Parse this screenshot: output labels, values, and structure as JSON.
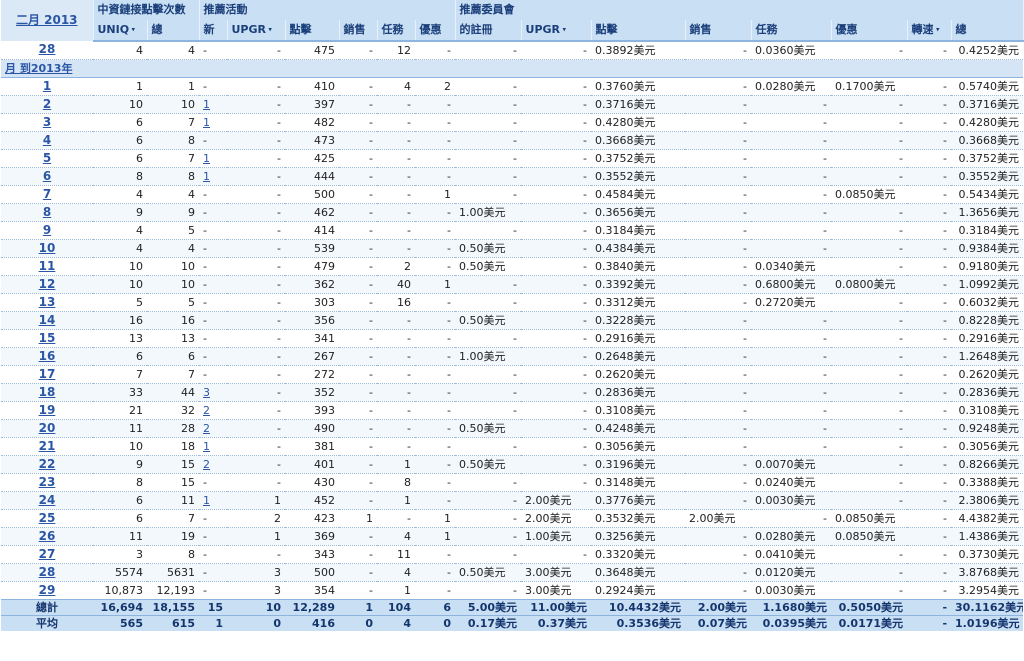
{
  "header": {
    "month_link": "二月 2013",
    "group_direct_clicks": "中資鏈接點擊次數",
    "group_campaign": "推薦活動",
    "group_committee": "推薦委員會",
    "cols": [
      "UNIQ",
      "總",
      "新",
      "UPGR",
      "點擊",
      "銷售",
      "任務",
      "優惠",
      "的註冊",
      "UPGR",
      "點擊",
      "銷售",
      "任務",
      "優惠",
      "轉速",
      "總"
    ],
    "sort_arrow": "▾"
  },
  "first_row": [
    "28",
    "4",
    "4",
    "-",
    "-",
    "475",
    "-",
    "12",
    "-",
    "-",
    "-",
    "0.3892美元",
    "-",
    "0.0360美元",
    "-",
    "-",
    "0.4252美元"
  ],
  "section_label": "月 到2013年",
  "rows": [
    [
      "1",
      "1",
      "1",
      "-",
      "-",
      "410",
      "-",
      "4",
      "2",
      "-",
      "-",
      "0.3760美元",
      "-",
      "0.0280美元",
      "0.1700美元",
      "-",
      "0.5740美元"
    ],
    [
      "2",
      "10",
      "10",
      "1",
      "-",
      "397",
      "-",
      "-",
      "-",
      "-",
      "-",
      "0.3716美元",
      "-",
      "-",
      "-",
      "-",
      "0.3716美元"
    ],
    [
      "3",
      "6",
      "7",
      "1",
      "-",
      "482",
      "-",
      "-",
      "-",
      "-",
      "-",
      "0.4280美元",
      "-",
      "-",
      "-",
      "-",
      "0.4280美元"
    ],
    [
      "4",
      "6",
      "8",
      "-",
      "-",
      "473",
      "-",
      "-",
      "-",
      "-",
      "-",
      "0.3668美元",
      "-",
      "-",
      "-",
      "-",
      "0.3668美元"
    ],
    [
      "5",
      "6",
      "7",
      "1",
      "-",
      "425",
      "-",
      "-",
      "-",
      "-",
      "-",
      "0.3752美元",
      "-",
      "-",
      "-",
      "-",
      "0.3752美元"
    ],
    [
      "6",
      "8",
      "8",
      "1",
      "-",
      "444",
      "-",
      "-",
      "-",
      "-",
      "-",
      "0.3552美元",
      "-",
      "-",
      "-",
      "-",
      "0.3552美元"
    ],
    [
      "7",
      "4",
      "4",
      "-",
      "-",
      "500",
      "-",
      "-",
      "1",
      "-",
      "-",
      "0.4584美元",
      "-",
      "-",
      "0.0850美元",
      "-",
      "0.5434美元"
    ],
    [
      "8",
      "9",
      "9",
      "-",
      "-",
      "462",
      "-",
      "-",
      "-",
      "1.00美元",
      "-",
      "0.3656美元",
      "-",
      "-",
      "-",
      "-",
      "1.3656美元"
    ],
    [
      "9",
      "4",
      "5",
      "-",
      "-",
      "414",
      "-",
      "-",
      "-",
      "-",
      "-",
      "0.3184美元",
      "-",
      "-",
      "-",
      "-",
      "0.3184美元"
    ],
    [
      "10",
      "4",
      "4",
      "-",
      "-",
      "539",
      "-",
      "-",
      "-",
      "0.50美元",
      "-",
      "0.4384美元",
      "-",
      "-",
      "-",
      "-",
      "0.9384美元"
    ],
    [
      "11",
      "10",
      "10",
      "-",
      "-",
      "479",
      "-",
      "2",
      "-",
      "0.50美元",
      "-",
      "0.3840美元",
      "-",
      "0.0340美元",
      "-",
      "-",
      "0.9180美元"
    ],
    [
      "12",
      "10",
      "10",
      "-",
      "-",
      "362",
      "-",
      "40",
      "1",
      "-",
      "-",
      "0.3392美元",
      "-",
      "0.6800美元",
      "0.0800美元",
      "-",
      "1.0992美元"
    ],
    [
      "13",
      "5",
      "5",
      "-",
      "-",
      "303",
      "-",
      "16",
      "-",
      "-",
      "-",
      "0.3312美元",
      "-",
      "0.2720美元",
      "-",
      "-",
      "0.6032美元"
    ],
    [
      "14",
      "16",
      "16",
      "-",
      "-",
      "356",
      "-",
      "-",
      "-",
      "0.50美元",
      "-",
      "0.3228美元",
      "-",
      "-",
      "-",
      "-",
      "0.8228美元"
    ],
    [
      "15",
      "13",
      "13",
      "-",
      "-",
      "341",
      "-",
      "-",
      "-",
      "-",
      "-",
      "0.2916美元",
      "-",
      "-",
      "-",
      "-",
      "0.2916美元"
    ],
    [
      "16",
      "6",
      "6",
      "-",
      "-",
      "267",
      "-",
      "-",
      "-",
      "1.00美元",
      "-",
      "0.2648美元",
      "-",
      "-",
      "-",
      "-",
      "1.2648美元"
    ],
    [
      "17",
      "7",
      "7",
      "-",
      "-",
      "272",
      "-",
      "-",
      "-",
      "-",
      "-",
      "0.2620美元",
      "-",
      "-",
      "-",
      "-",
      "0.2620美元"
    ],
    [
      "18",
      "33",
      "44",
      "3",
      "-",
      "352",
      "-",
      "-",
      "-",
      "-",
      "-",
      "0.2836美元",
      "-",
      "-",
      "-",
      "-",
      "0.2836美元"
    ],
    [
      "19",
      "21",
      "32",
      "2",
      "-",
      "393",
      "-",
      "-",
      "-",
      "-",
      "-",
      "0.3108美元",
      "-",
      "-",
      "-",
      "-",
      "0.3108美元"
    ],
    [
      "20",
      "11",
      "28",
      "2",
      "-",
      "490",
      "-",
      "-",
      "-",
      "0.50美元",
      "-",
      "0.4248美元",
      "-",
      "-",
      "-",
      "-",
      "0.9248美元"
    ],
    [
      "21",
      "10",
      "18",
      "1",
      "-",
      "381",
      "-",
      "-",
      "-",
      "-",
      "-",
      "0.3056美元",
      "-",
      "-",
      "-",
      "-",
      "0.3056美元"
    ],
    [
      "22",
      "9",
      "15",
      "2",
      "-",
      "401",
      "-",
      "1",
      "-",
      "0.50美元",
      "-",
      "0.3196美元",
      "-",
      "0.0070美元",
      "-",
      "-",
      "0.8266美元"
    ],
    [
      "23",
      "8",
      "15",
      "-",
      "-",
      "430",
      "-",
      "8",
      "-",
      "-",
      "-",
      "0.3148美元",
      "-",
      "0.0240美元",
      "-",
      "-",
      "0.3388美元"
    ],
    [
      "24",
      "6",
      "11",
      "1",
      "1",
      "452",
      "-",
      "1",
      "-",
      "-",
      "2.00美元",
      "0.3776美元",
      "-",
      "0.0030美元",
      "-",
      "-",
      "2.3806美元"
    ],
    [
      "25",
      "6",
      "7",
      "-",
      "2",
      "423",
      "1",
      "-",
      "1",
      "-",
      "2.00美元",
      "0.3532美元",
      "2.00美元",
      "-",
      "0.0850美元",
      "-",
      "4.4382美元"
    ],
    [
      "26",
      "11",
      "19",
      "-",
      "1",
      "369",
      "-",
      "4",
      "1",
      "-",
      "1.00美元",
      "0.3256美元",
      "-",
      "0.0280美元",
      "0.0850美元",
      "-",
      "1.4386美元"
    ],
    [
      "27",
      "3",
      "8",
      "-",
      "-",
      "343",
      "-",
      "11",
      "-",
      "-",
      "-",
      "0.3320美元",
      "-",
      "0.0410美元",
      "-",
      "-",
      "0.3730美元"
    ],
    [
      "28",
      "5574",
      "5631",
      "-",
      "3",
      "500",
      "-",
      "4",
      "-",
      "0.50美元",
      "3.00美元",
      "0.3648美元",
      "-",
      "0.0120美元",
      "-",
      "-",
      "3.8768美元"
    ],
    [
      "29",
      "10,873",
      "12,193",
      "-",
      "3",
      "354",
      "-",
      "1",
      "-",
      "-",
      "3.00美元",
      "0.2924美元",
      "-",
      "0.0030美元",
      "-",
      "-",
      "3.2954美元"
    ]
  ],
  "totals": [
    "總計",
    "16,694",
    "18,155",
    "15",
    "10",
    "12,289",
    "1",
    "104",
    "6",
    "5.00美元",
    "11.00美元",
    "10.4432美元",
    "2.00美元",
    "1.1680美元",
    "0.5050美元",
    "-",
    "30.1162美元"
  ],
  "averages": [
    "平均",
    "565",
    "615",
    "1",
    "0",
    "416",
    "0",
    "4",
    "0",
    "0.17美元",
    "0.37美元",
    "0.3536美元",
    "0.07美元",
    "0.0395美元",
    "0.0171美元",
    "-",
    "1.0196美元"
  ]
}
